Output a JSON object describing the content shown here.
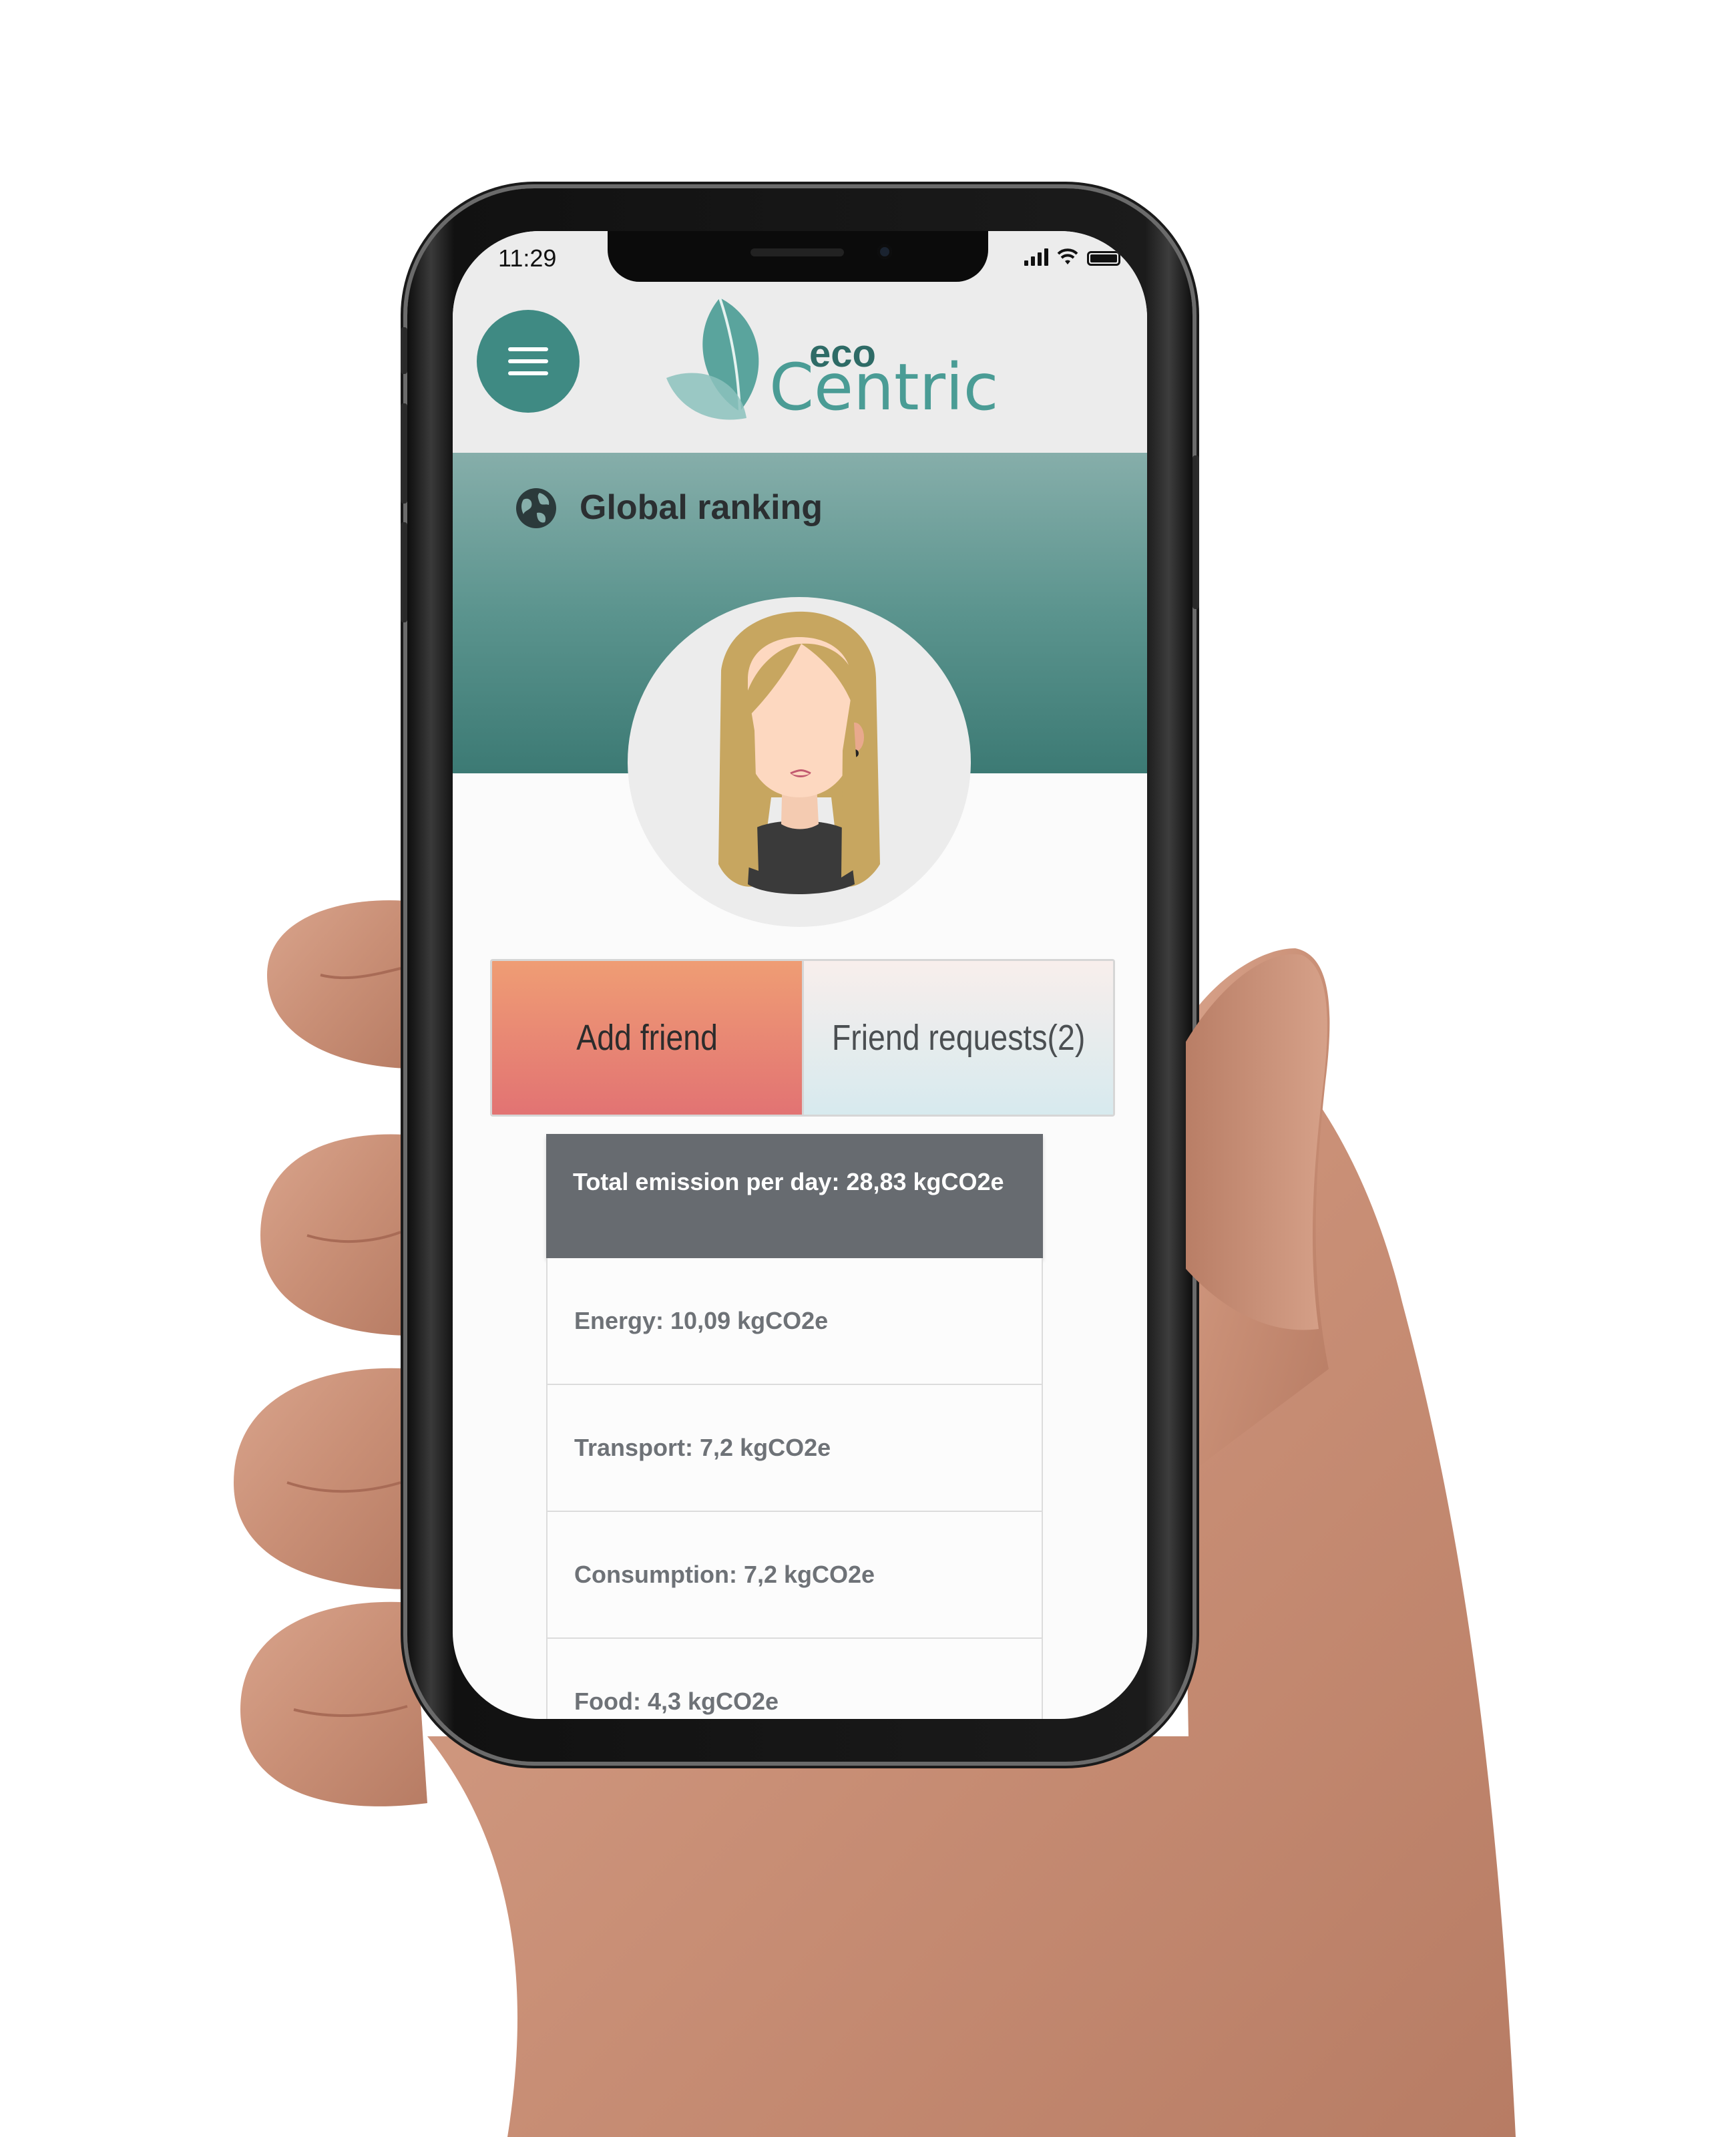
{
  "status_bar": {
    "time": "11:29"
  },
  "header": {
    "menu_icon": "hamburger-menu-icon",
    "logo": {
      "eco": "eco",
      "centric": "Centric"
    }
  },
  "banner": {
    "icon": "globe-icon",
    "title": "Global ranking"
  },
  "profile": {
    "avatar": "woman-avatar"
  },
  "tabs": [
    {
      "label": "Add friend"
    },
    {
      "label": "Friend requests(2)"
    }
  ],
  "emissions": {
    "total": "Total emission per day:  28,83 kgCO2e",
    "items": [
      {
        "label": "Energy: 10,09 kgCO2e"
      },
      {
        "label": "Transport: 7,2 kgCO2e"
      },
      {
        "label": "Consumption:  7,2 kgCO2e"
      },
      {
        "label": "Food: 4,3 kgCO2e"
      }
    ]
  },
  "colors": {
    "brand_teal": "#3f8a83",
    "add_friend_gradient": [
      "#ef9d74",
      "#e27373"
    ],
    "total_header": "#676b70"
  }
}
